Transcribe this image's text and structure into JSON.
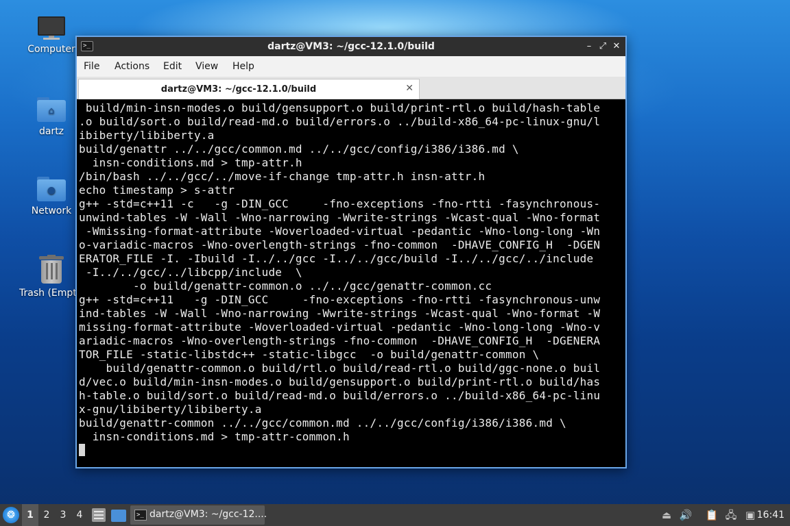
{
  "desktop": {
    "icons": [
      {
        "label": "Computer",
        "icon": "computer-icon"
      },
      {
        "label": "dartz",
        "icon": "home-folder-icon"
      },
      {
        "label": "Network",
        "icon": "network-folder-icon"
      },
      {
        "label": "Trash (Empt",
        "icon": "trash-icon"
      }
    ]
  },
  "window": {
    "title": "dartz@VM3: ~/gcc-12.1.0/build",
    "controls": {
      "minimize": "–",
      "maximize": "⤢",
      "close": "✕"
    },
    "menu": [
      "File",
      "Actions",
      "Edit",
      "View",
      "Help"
    ],
    "tab": {
      "label": "dartz@VM3: ~/gcc-12.1.0/build",
      "close": "✕"
    },
    "terminal_lines": [
      " build/min-insn-modes.o build/gensupport.o build/print-rtl.o build/hash-table",
      ".o build/sort.o build/read-md.o build/errors.o ../build-x86_64-pc-linux-gnu/l",
      "ibiberty/libiberty.a",
      "build/genattr ../../gcc/common.md ../../gcc/config/i386/i386.md \\",
      "  insn-conditions.md > tmp-attr.h",
      "/bin/bash ../../gcc/../move-if-change tmp-attr.h insn-attr.h",
      "echo timestamp > s-attr",
      "g++ -std=c++11 -c   -g -DIN_GCC     -fno-exceptions -fno-rtti -fasynchronous-",
      "unwind-tables -W -Wall -Wno-narrowing -Wwrite-strings -Wcast-qual -Wno-format",
      " -Wmissing-format-attribute -Woverloaded-virtual -pedantic -Wno-long-long -Wn",
      "o-variadic-macros -Wno-overlength-strings -fno-common  -DHAVE_CONFIG_H  -DGEN",
      "ERATOR_FILE -I. -Ibuild -I../../gcc -I../../gcc/build -I../../gcc/../include",
      " -I../../gcc/../libcpp/include  \\",
      "        -o build/genattr-common.o ../../gcc/genattr-common.cc",
      "g++ -std=c++11   -g -DIN_GCC     -fno-exceptions -fno-rtti -fasynchronous-unw",
      "ind-tables -W -Wall -Wno-narrowing -Wwrite-strings -Wcast-qual -Wno-format -W",
      "missing-format-attribute -Woverloaded-virtual -pedantic -Wno-long-long -Wno-v",
      "ariadic-macros -Wno-overlength-strings -fno-common  -DHAVE_CONFIG_H  -DGENERA",
      "TOR_FILE -static-libstdc++ -static-libgcc  -o build/genattr-common \\",
      "    build/genattr-common.o build/rtl.o build/read-rtl.o build/ggc-none.o buil",
      "d/vec.o build/min-insn-modes.o build/gensupport.o build/print-rtl.o build/has",
      "h-table.o build/sort.o build/read-md.o build/errors.o ../build-x86_64-pc-linu",
      "x-gnu/libiberty/libiberty.a",
      "build/genattr-common ../../gcc/common.md ../../gcc/config/i386/i386.md \\",
      "  insn-conditions.md > tmp-attr-common.h"
    ]
  },
  "taskbar": {
    "workspaces": [
      "1",
      "2",
      "3",
      "4"
    ],
    "active_workspace": "1",
    "task_label": "dartz@VM3: ~/gcc-12....",
    "clock": "16:41"
  }
}
